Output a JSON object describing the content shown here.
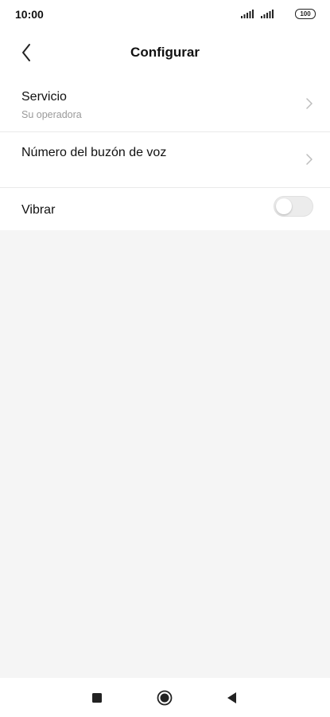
{
  "status_bar": {
    "time": "10:00",
    "battery": "100",
    "icons": [
      "signal-icon",
      "signal-icon",
      "battery-icon"
    ]
  },
  "header": {
    "title": "Configurar",
    "back_icon": "chevron-left-icon"
  },
  "settings": {
    "items": [
      {
        "label": "Servicio",
        "sublabel": "Su operadora",
        "control": "chevron-right-icon"
      },
      {
        "label": "Número del buzón de voz",
        "control": "chevron-right-icon"
      },
      {
        "label": "Vibrar",
        "control": "toggle",
        "toggle_on": false
      }
    ]
  },
  "nav_bar": {
    "icons": [
      "recents-square-icon",
      "home-circle-icon",
      "back-triangle-icon"
    ]
  },
  "colors": {
    "background": "#ffffff",
    "empty_area": "#f5f5f5",
    "secondary_text": "#9a9a9a",
    "toggle_off": "#ececec"
  }
}
